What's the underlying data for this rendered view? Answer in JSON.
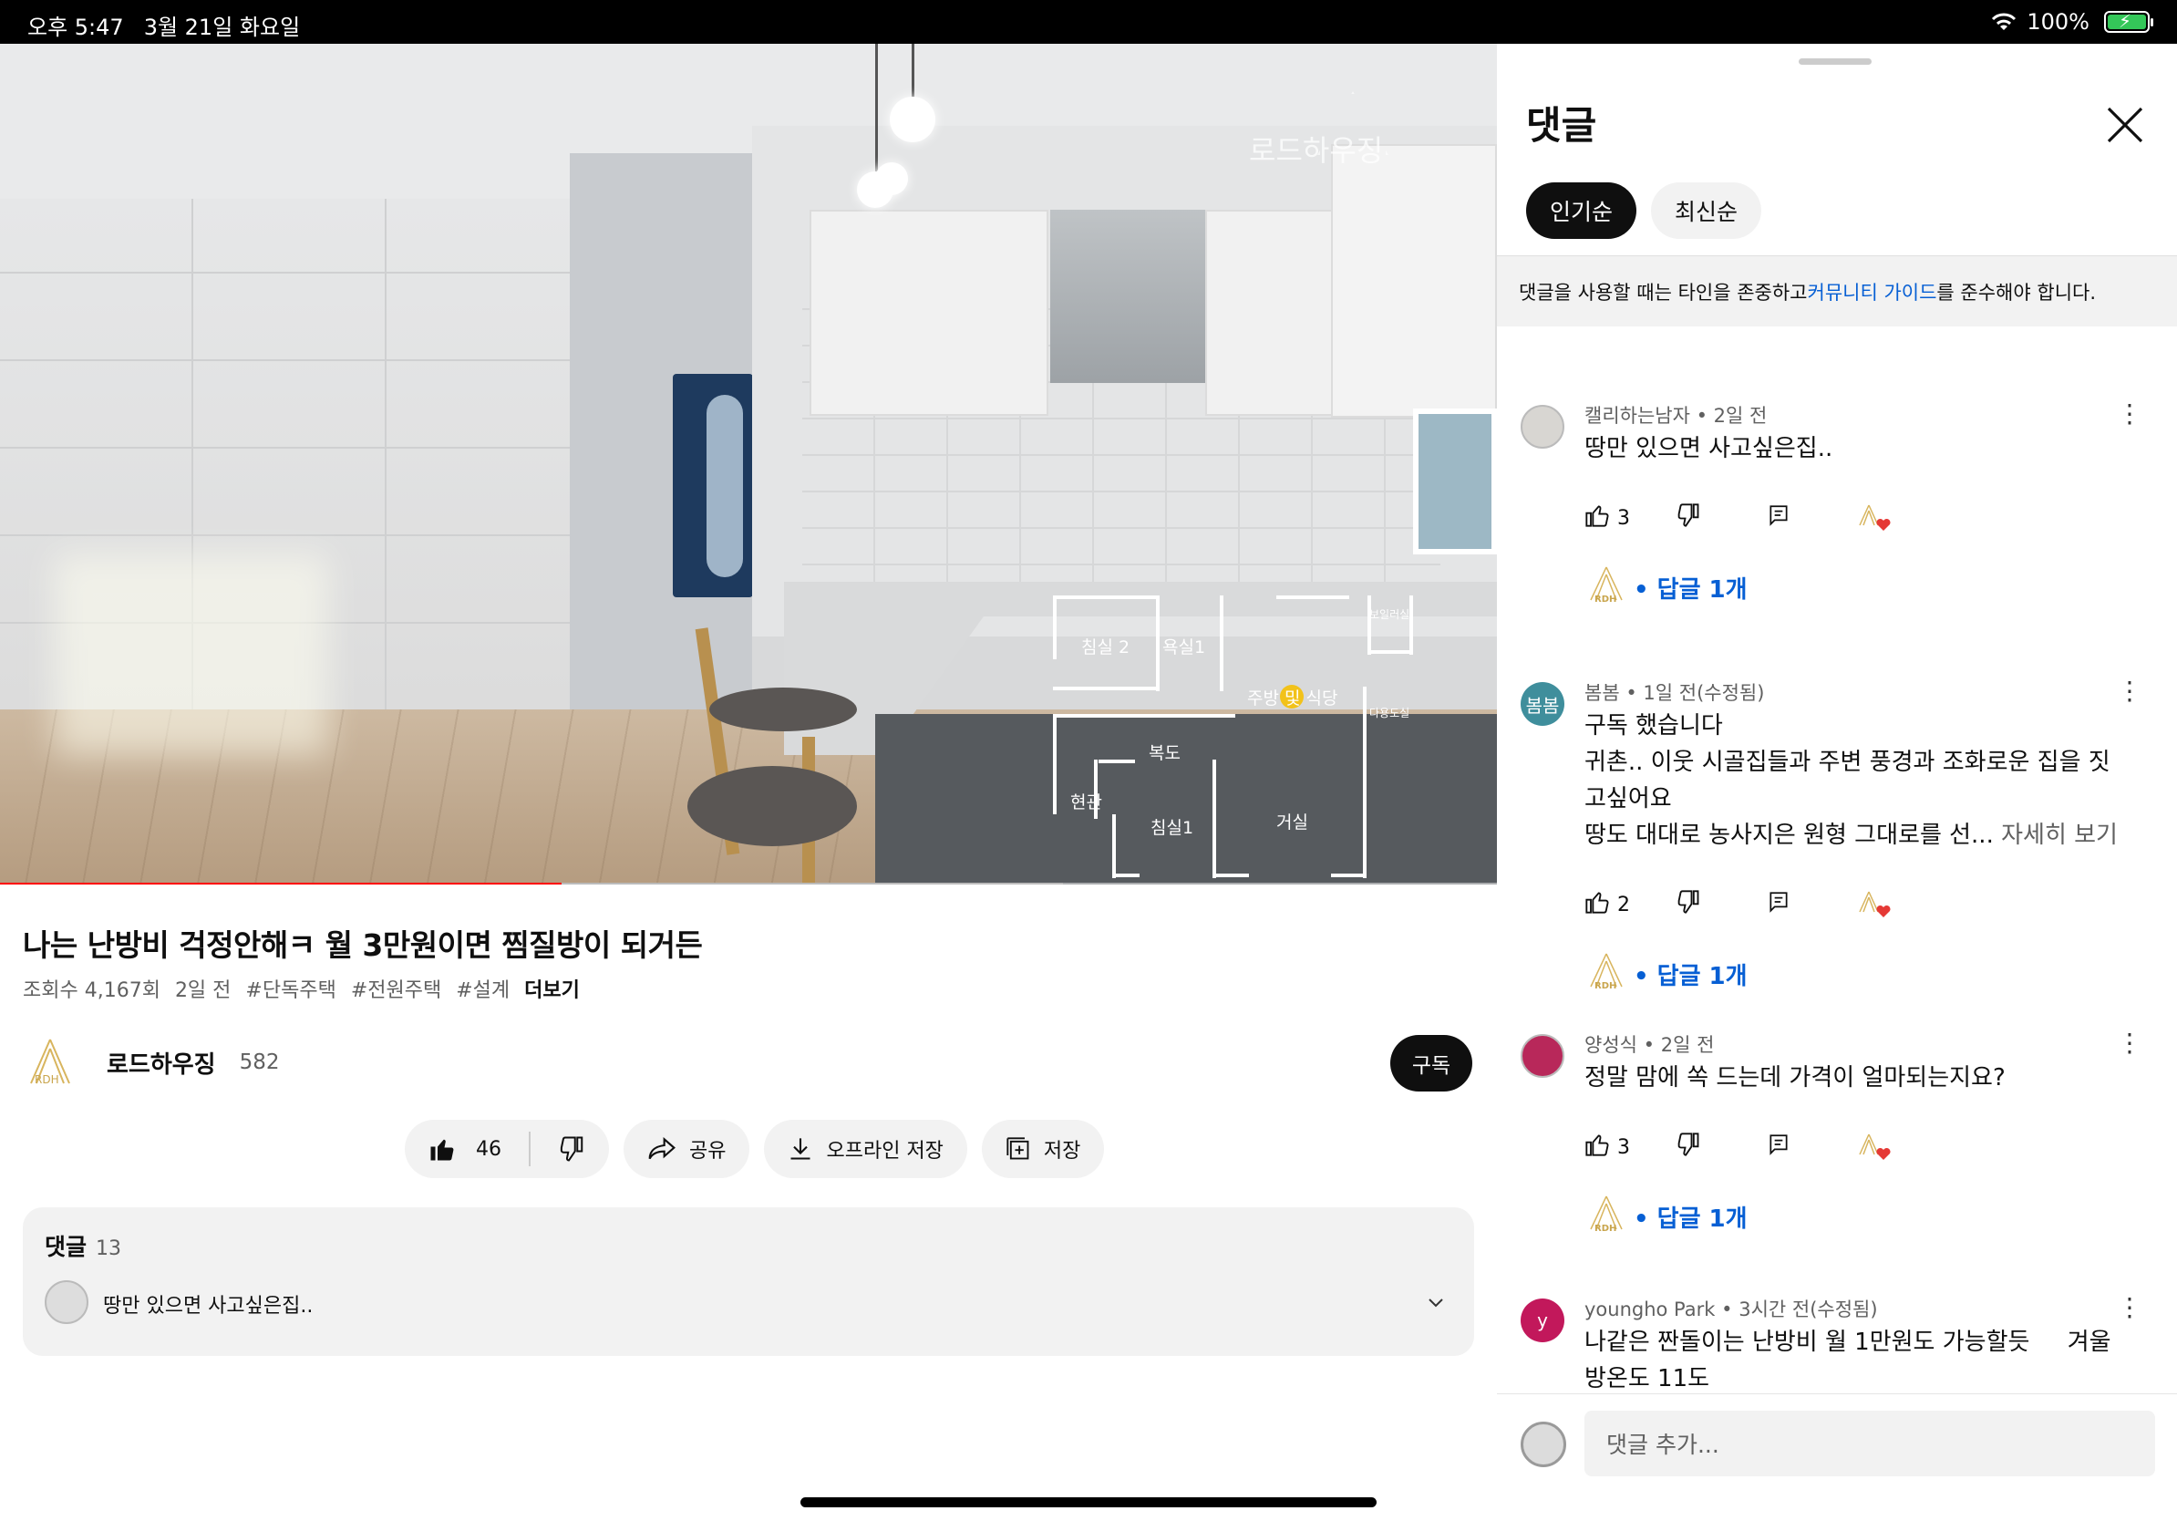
{
  "statusbar": {
    "time": "오후 5:47",
    "date": "3월 21일 화요일",
    "battery": "100%",
    "battery_level": 1.0
  },
  "video": {
    "progress_played": 0.375,
    "progress_buffered": 0.71,
    "watermark": "로드하우징",
    "floorplan": {
      "rooms": [
        "침실 2",
        "욕실1",
        "주방 및 식당",
        "보일러실",
        "다용도실",
        "복도",
        "현관",
        "침실1",
        "거실"
      ]
    }
  },
  "info": {
    "title": "나는 난방비 걱정안해ㅋ 월 3만원이면 찜질방이 되거든",
    "views": "조회수 4,167회",
    "age": "2일 전",
    "tags": [
      "#단독주택",
      "#전원주택",
      "#설계"
    ],
    "more": "더보기",
    "channel": {
      "name": "로드하우징",
      "subs": "582",
      "subscribe": "구독"
    },
    "actions": {
      "likes": "46",
      "share": "공유",
      "offline": "오프라인 저장",
      "save": "저장"
    },
    "comments_card": {
      "label": "댓글",
      "count": "13",
      "preview": "땅만 있으면 사고싶은집.."
    }
  },
  "panel": {
    "title": "댓글",
    "tabs": [
      "인기순",
      "최신순"
    ],
    "notice_before": "댓글을 사용할 때는 타인을 존중하고 ",
    "notice_link": "커뮤니티 가이드",
    "notice_after": "를 준수해야 합니다.",
    "comments": [
      {
        "author": "캘리하는남자",
        "time": "2일 전",
        "lines": [
          "땅만 있으면 사고싶은집.."
        ],
        "more": "",
        "likes": "3",
        "replies": "• 답글 1개",
        "avatar_text": "",
        "avatar_color": "#d8d6d2"
      },
      {
        "author": "봄봄",
        "time": "1일 전(수정됨)",
        "lines": [
          "구독 했습니다",
          "귀촌.. 이웃 시골집들과 주변 풍경과 조화로운 집을 짓",
          "고싶어요",
          "땅도 대대로 농사지은 원형 그대로를 선..."
        ],
        "more": " 자세히 보기",
        "likes": "2",
        "replies": "• 답글 1개",
        "avatar_text": "봄봄",
        "avatar_color": "#3f8e9c"
      },
      {
        "author": "양성식",
        "time": "2일 전",
        "lines": [
          "정말 맘에 쏙 드는데 가격이 얼마되는지요?"
        ],
        "more": "",
        "likes": "3",
        "replies": "• 답글 1개",
        "avatar_text": "",
        "avatar_color": "#b8285a"
      },
      {
        "author": "youngho Park",
        "time": "3시간 전(수정됨)",
        "lines": [
          "나같은 짠돌이는 난방비 월 1만원도 가능할듯     겨울",
          "방온도 11도"
        ],
        "more": "",
        "likes": "",
        "replies": "",
        "avatar_text": "y",
        "avatar_color": "#c2185b"
      }
    ],
    "add_placeholder": "댓글 추가..."
  },
  "colors": {
    "accent_red": "#ff0000",
    "link_blue": "#065fd4",
    "dark": "#0f0f0f"
  }
}
